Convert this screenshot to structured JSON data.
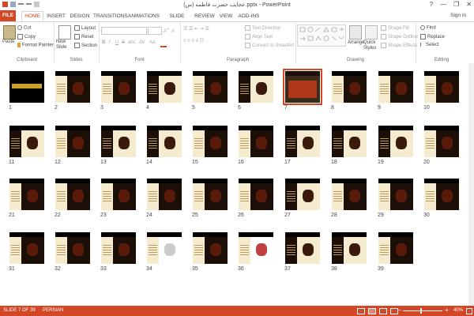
{
  "window": {
    "title": "عجایب حضرت فاطمه (س).pptx - PowerPoint",
    "help": "?",
    "minimize": "—",
    "restore": "❐",
    "close": "✕",
    "sign_in": "Sign in"
  },
  "tabs": [
    "FILE",
    "HOME",
    "INSERT",
    "DESIGN",
    "TRANSITIONS",
    "ANIMATIONS",
    "SLIDE SHOW",
    "REVIEW",
    "VIEW",
    "ADD-INS"
  ],
  "ribbon": {
    "clipboard": {
      "label": "Clipboard",
      "paste": "Paste",
      "cut": "Cut",
      "copy": "Copy",
      "format_painter": "Format Painter"
    },
    "slides": {
      "label": "Slides",
      "new_slide": "New Slide",
      "layout": "Layout",
      "reset": "Reset",
      "section": "Section"
    },
    "font": {
      "label": "Font",
      "bold": "B",
      "italic": "I",
      "underline": "U",
      "strike": "S",
      "shadow": "abc",
      "spacing": "AV",
      "case": "Aa"
    },
    "paragraph": {
      "label": "Paragraph",
      "text_direction": "Text Direction",
      "align_text": "Align Text",
      "convert_smartart": "Convert to SmartArt"
    },
    "drawing": {
      "label": "Drawing",
      "arrange": "Arrange",
      "quick_styles": "Quick Styles",
      "shape_fill": "Shape Fill",
      "shape_outline": "Shape Outline",
      "shape_effects": "Shape Effects"
    },
    "editing": {
      "label": "Editing",
      "find": "Find",
      "replace": "Replace",
      "select": "Select"
    }
  },
  "slides": [
    {
      "n": "1",
      "style": "title"
    },
    {
      "n": "2",
      "style": "A"
    },
    {
      "n": "3",
      "style": "A"
    },
    {
      "n": "4",
      "style": "B"
    },
    {
      "n": "5",
      "style": "A"
    },
    {
      "n": "6",
      "style": "B"
    },
    {
      "n": "7",
      "style": "sel"
    },
    {
      "n": "8",
      "style": "A"
    },
    {
      "n": "9",
      "style": "A"
    },
    {
      "n": "10",
      "style": "A"
    },
    {
      "n": "11",
      "style": "B"
    },
    {
      "n": "12",
      "style": "A"
    },
    {
      "n": "13",
      "style": "B"
    },
    {
      "n": "14",
      "style": "B"
    },
    {
      "n": "15",
      "style": "A"
    },
    {
      "n": "16",
      "style": "A"
    },
    {
      "n": "17",
      "style": "B"
    },
    {
      "n": "18",
      "style": "B"
    },
    {
      "n": "19",
      "style": "B"
    },
    {
      "n": "20",
      "style": "A"
    },
    {
      "n": "21",
      "style": "A"
    },
    {
      "n": "22",
      "style": "A"
    },
    {
      "n": "23",
      "style": "A"
    },
    {
      "n": "24",
      "style": "A"
    },
    {
      "n": "25",
      "style": "A"
    },
    {
      "n": "26",
      "style": "A"
    },
    {
      "n": "27",
      "style": "B"
    },
    {
      "n": "28",
      "style": "A"
    },
    {
      "n": "29",
      "style": "A"
    },
    {
      "n": "30",
      "style": "A"
    },
    {
      "n": "31",
      "style": "A"
    },
    {
      "n": "32",
      "style": "A"
    },
    {
      "n": "33",
      "style": "A"
    },
    {
      "n": "34",
      "style": "W"
    },
    {
      "n": "35",
      "style": "A"
    },
    {
      "n": "36",
      "style": "P"
    },
    {
      "n": "37",
      "style": "B"
    },
    {
      "n": "38",
      "style": "B"
    },
    {
      "n": "39",
      "style": "A"
    }
  ],
  "status": {
    "slide_info": "SLIDE 7 OF 39",
    "language": "PERSIAN",
    "zoom_minus": "−",
    "zoom_plus": "+",
    "zoom": "40%"
  },
  "colors": {
    "accent": "#d24726",
    "thumb_bg": "#f5ebcf",
    "thumb_dark": "#1c0f08",
    "thumb_warm": "#b0381a"
  }
}
